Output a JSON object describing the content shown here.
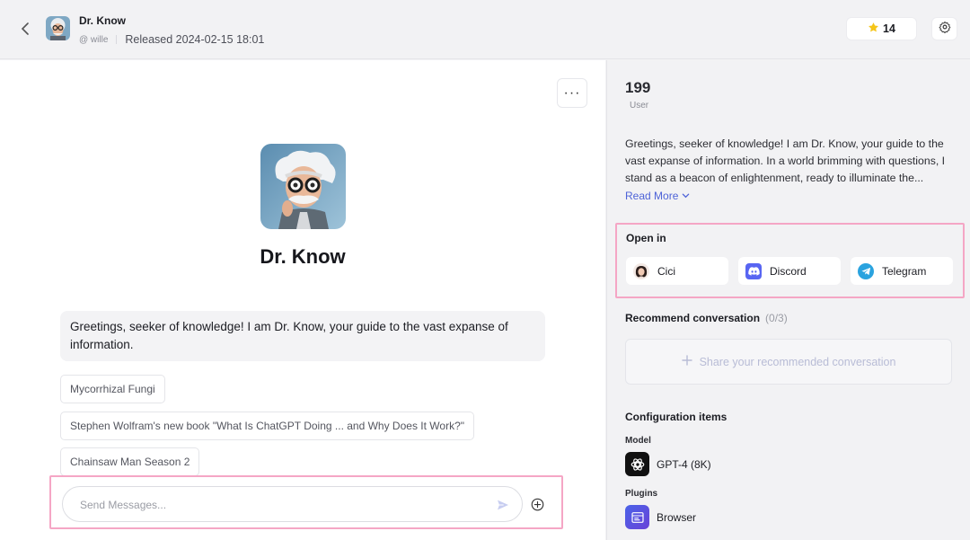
{
  "header": {
    "title": "Dr. Know",
    "author": "@ wille",
    "released": "Released 2024-02-15 18:01",
    "star_count": "14"
  },
  "chat": {
    "bot_name": "Dr. Know",
    "greeting": "Greetings, seeker of knowledge! I am Dr. Know, your guide to the vast expanse of information.",
    "suggestions": [
      "Mycorrhizal Fungi",
      "Stephen Wolfram's new book \"What Is ChatGPT Doing ... and Why Does It Work?\"",
      "Chainsaw Man Season 2"
    ],
    "input_placeholder": "Send Messages..."
  },
  "sidebar": {
    "user_count": "199",
    "user_label": "User",
    "description": "Greetings, seeker of knowledge! I am Dr. Know, your guide to the vast expanse of information. In a world brimming with questions, I stand as a beacon of enlightenment, ready to illuminate the...",
    "read_more": "Read More",
    "open_in": {
      "title": "Open in",
      "apps": [
        {
          "label": "Cici",
          "icon": "cici-avatar-icon"
        },
        {
          "label": "Discord",
          "icon": "discord-icon",
          "color": "#5865f2"
        },
        {
          "label": "Telegram",
          "icon": "telegram-icon",
          "color": "#2aa3df"
        }
      ]
    },
    "recommend": {
      "title": "Recommend conversation",
      "count": "(0/3)",
      "share_label": "Share your recommended conversation"
    },
    "config": {
      "title": "Configuration items",
      "model_label": "Model",
      "model_value": "GPT-4 (8K)",
      "plugins_label": "Plugins",
      "plugin_value": "Browser"
    }
  },
  "colors": {
    "accent": "#4e63d8",
    "highlight_border": "#f5a6c5",
    "star": "#f5c518"
  }
}
